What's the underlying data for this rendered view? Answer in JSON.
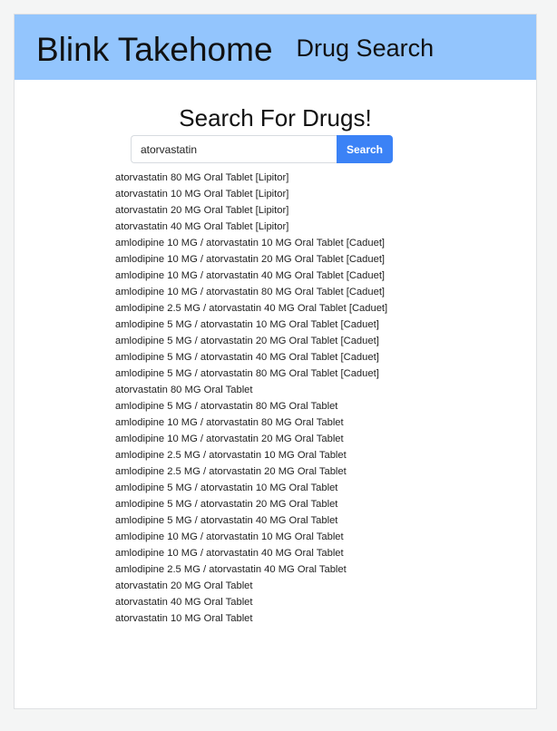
{
  "header": {
    "brand": "Blink Takehome",
    "nav_link": "Drug Search"
  },
  "main": {
    "title": "Search For Drugs!",
    "search": {
      "value": "atorvastatin",
      "button_label": "Search"
    },
    "results": [
      "atorvastatin 80 MG Oral Tablet [Lipitor]",
      "atorvastatin 10 MG Oral Tablet [Lipitor]",
      "atorvastatin 20 MG Oral Tablet [Lipitor]",
      "atorvastatin 40 MG Oral Tablet [Lipitor]",
      "amlodipine 10 MG / atorvastatin 10 MG Oral Tablet [Caduet]",
      "amlodipine 10 MG / atorvastatin 20 MG Oral Tablet [Caduet]",
      "amlodipine 10 MG / atorvastatin 40 MG Oral Tablet [Caduet]",
      "amlodipine 10 MG / atorvastatin 80 MG Oral Tablet [Caduet]",
      "amlodipine 2.5 MG / atorvastatin 40 MG Oral Tablet [Caduet]",
      "amlodipine 5 MG / atorvastatin 10 MG Oral Tablet [Caduet]",
      "amlodipine 5 MG / atorvastatin 20 MG Oral Tablet [Caduet]",
      "amlodipine 5 MG / atorvastatin 40 MG Oral Tablet [Caduet]",
      "amlodipine 5 MG / atorvastatin 80 MG Oral Tablet [Caduet]",
      "atorvastatin 80 MG Oral Tablet",
      "amlodipine 5 MG / atorvastatin 80 MG Oral Tablet",
      "amlodipine 10 MG / atorvastatin 80 MG Oral Tablet",
      "amlodipine 10 MG / atorvastatin 20 MG Oral Tablet",
      "amlodipine 2.5 MG / atorvastatin 10 MG Oral Tablet",
      "amlodipine 2.5 MG / atorvastatin 20 MG Oral Tablet",
      "amlodipine 5 MG / atorvastatin 10 MG Oral Tablet",
      "amlodipine 5 MG / atorvastatin 20 MG Oral Tablet",
      "amlodipine 5 MG / atorvastatin 40 MG Oral Tablet",
      "amlodipine 10 MG / atorvastatin 10 MG Oral Tablet",
      "amlodipine 10 MG / atorvastatin 40 MG Oral Tablet",
      "amlodipine 2.5 MG / atorvastatin 40 MG Oral Tablet",
      "atorvastatin 20 MG Oral Tablet",
      "atorvastatin 40 MG Oral Tablet",
      "atorvastatin 10 MG Oral Tablet"
    ]
  },
  "colors": {
    "header_bg": "#93c5fd",
    "button_bg": "#3b82f6",
    "page_bg": "#f4f5f5"
  }
}
